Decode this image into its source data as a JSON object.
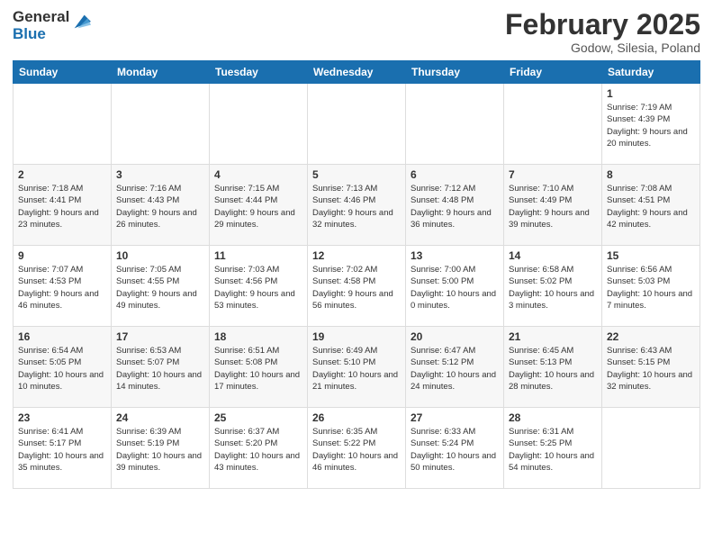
{
  "logo": {
    "general": "General",
    "blue": "Blue"
  },
  "header": {
    "month": "February 2025",
    "location": "Godow, Silesia, Poland"
  },
  "weekdays": [
    "Sunday",
    "Monday",
    "Tuesday",
    "Wednesday",
    "Thursday",
    "Friday",
    "Saturday"
  ],
  "weeks": [
    [
      {
        "day": "",
        "info": ""
      },
      {
        "day": "",
        "info": ""
      },
      {
        "day": "",
        "info": ""
      },
      {
        "day": "",
        "info": ""
      },
      {
        "day": "",
        "info": ""
      },
      {
        "day": "",
        "info": ""
      },
      {
        "day": "1",
        "info": "Sunrise: 7:19 AM\nSunset: 4:39 PM\nDaylight: 9 hours and 20 minutes."
      }
    ],
    [
      {
        "day": "2",
        "info": "Sunrise: 7:18 AM\nSunset: 4:41 PM\nDaylight: 9 hours and 23 minutes."
      },
      {
        "day": "3",
        "info": "Sunrise: 7:16 AM\nSunset: 4:43 PM\nDaylight: 9 hours and 26 minutes."
      },
      {
        "day": "4",
        "info": "Sunrise: 7:15 AM\nSunset: 4:44 PM\nDaylight: 9 hours and 29 minutes."
      },
      {
        "day": "5",
        "info": "Sunrise: 7:13 AM\nSunset: 4:46 PM\nDaylight: 9 hours and 32 minutes."
      },
      {
        "day": "6",
        "info": "Sunrise: 7:12 AM\nSunset: 4:48 PM\nDaylight: 9 hours and 36 minutes."
      },
      {
        "day": "7",
        "info": "Sunrise: 7:10 AM\nSunset: 4:49 PM\nDaylight: 9 hours and 39 minutes."
      },
      {
        "day": "8",
        "info": "Sunrise: 7:08 AM\nSunset: 4:51 PM\nDaylight: 9 hours and 42 minutes."
      }
    ],
    [
      {
        "day": "9",
        "info": "Sunrise: 7:07 AM\nSunset: 4:53 PM\nDaylight: 9 hours and 46 minutes."
      },
      {
        "day": "10",
        "info": "Sunrise: 7:05 AM\nSunset: 4:55 PM\nDaylight: 9 hours and 49 minutes."
      },
      {
        "day": "11",
        "info": "Sunrise: 7:03 AM\nSunset: 4:56 PM\nDaylight: 9 hours and 53 minutes."
      },
      {
        "day": "12",
        "info": "Sunrise: 7:02 AM\nSunset: 4:58 PM\nDaylight: 9 hours and 56 minutes."
      },
      {
        "day": "13",
        "info": "Sunrise: 7:00 AM\nSunset: 5:00 PM\nDaylight: 10 hours and 0 minutes."
      },
      {
        "day": "14",
        "info": "Sunrise: 6:58 AM\nSunset: 5:02 PM\nDaylight: 10 hours and 3 minutes."
      },
      {
        "day": "15",
        "info": "Sunrise: 6:56 AM\nSunset: 5:03 PM\nDaylight: 10 hours and 7 minutes."
      }
    ],
    [
      {
        "day": "16",
        "info": "Sunrise: 6:54 AM\nSunset: 5:05 PM\nDaylight: 10 hours and 10 minutes."
      },
      {
        "day": "17",
        "info": "Sunrise: 6:53 AM\nSunset: 5:07 PM\nDaylight: 10 hours and 14 minutes."
      },
      {
        "day": "18",
        "info": "Sunrise: 6:51 AM\nSunset: 5:08 PM\nDaylight: 10 hours and 17 minutes."
      },
      {
        "day": "19",
        "info": "Sunrise: 6:49 AM\nSunset: 5:10 PM\nDaylight: 10 hours and 21 minutes."
      },
      {
        "day": "20",
        "info": "Sunrise: 6:47 AM\nSunset: 5:12 PM\nDaylight: 10 hours and 24 minutes."
      },
      {
        "day": "21",
        "info": "Sunrise: 6:45 AM\nSunset: 5:13 PM\nDaylight: 10 hours and 28 minutes."
      },
      {
        "day": "22",
        "info": "Sunrise: 6:43 AM\nSunset: 5:15 PM\nDaylight: 10 hours and 32 minutes."
      }
    ],
    [
      {
        "day": "23",
        "info": "Sunrise: 6:41 AM\nSunset: 5:17 PM\nDaylight: 10 hours and 35 minutes."
      },
      {
        "day": "24",
        "info": "Sunrise: 6:39 AM\nSunset: 5:19 PM\nDaylight: 10 hours and 39 minutes."
      },
      {
        "day": "25",
        "info": "Sunrise: 6:37 AM\nSunset: 5:20 PM\nDaylight: 10 hours and 43 minutes."
      },
      {
        "day": "26",
        "info": "Sunrise: 6:35 AM\nSunset: 5:22 PM\nDaylight: 10 hours and 46 minutes."
      },
      {
        "day": "27",
        "info": "Sunrise: 6:33 AM\nSunset: 5:24 PM\nDaylight: 10 hours and 50 minutes."
      },
      {
        "day": "28",
        "info": "Sunrise: 6:31 AM\nSunset: 5:25 PM\nDaylight: 10 hours and 54 minutes."
      },
      {
        "day": "",
        "info": ""
      }
    ]
  ]
}
